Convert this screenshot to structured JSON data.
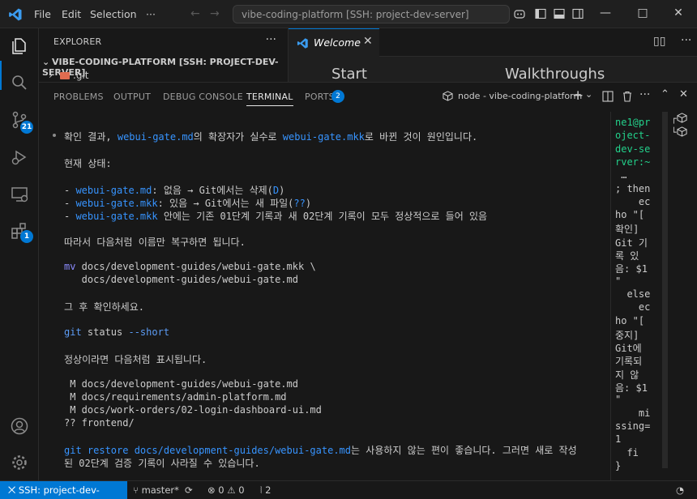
{
  "titlebar": {
    "menu": [
      "File",
      "Edit",
      "Selection",
      "···"
    ],
    "search_text": "vibe-coding-platform [SSH: project-dev-server]",
    "back_icon": "arrow-left-icon",
    "forward_icon": "arrow-right-icon"
  },
  "activity": {
    "scm_badge": "21",
    "extensions_badge": "1"
  },
  "explorer": {
    "title": "EXPLORER",
    "more": "···",
    "root_label": "VIBE-CODING-PLATFORM [SSH: PROJECT-DEV-SERVER]",
    "items": [
      ".git"
    ]
  },
  "editor": {
    "tab_label": "Welcome",
    "start_heading": "Start",
    "walkthroughs_heading": "Walkthroughs"
  },
  "panel": {
    "tabs": [
      "PROBLEMS",
      "OUTPUT",
      "DEBUG CONSOLE",
      "TERMINAL",
      "PORTS"
    ],
    "ports_badge": "2",
    "terminal_name": "node - vibe-coding-platform"
  },
  "terminal": {
    "l1_a": "확인 결과, ",
    "l1_b": "webui-gate.md",
    "l1_c": "의 확장자가 실수로 ",
    "l1_d": "webui-gate.mkk",
    "l1_e": "로 바뀐 것이 원인입니다.",
    "l2": "현재 상태:",
    "l3_a": "- ",
    "l3_b": "webui-gate.md",
    "l3_c": ": 없음 → Git에서는 삭제(",
    "l3_d": "D",
    "l3_e": ")",
    "l4_a": "- ",
    "l4_b": "webui-gate.mkk",
    "l4_c": ": 있음 → Git에서는 새 파일(",
    "l4_d": "??",
    "l4_e": ")",
    "l5_a": "- ",
    "l5_b": "webui-gate.mkk",
    "l5_c": " 안에는 기존 01단계 기록과 새 02단계 기록이 모두 정상적으로 들어 있음",
    "l6": "따라서 다음처럼 이름만 복구하면 됩니다.",
    "l7_a": "mv",
    "l7_b": " docs/development-guides/webui-gate.mkk \\",
    "l8": "   docs/development-guides/webui-gate.md",
    "l9": "그 후 확인하세요.",
    "l10_a": "git",
    "l10_b": " status ",
    "l10_c": "--short",
    "l11": "정상이라면 다음처럼 표시됩니다.",
    "l12": " M docs/development-guides/webui-gate.md",
    "l13": " M docs/requirements/admin-platform.md",
    "l14": " M docs/work-orders/02-login-dashboard-ui.md",
    "l15": "?? frontend/",
    "l16_a": "git restore docs/development-guides/webui-gate.md",
    "l16_b": "는 사용하지 않는 편이 좋습니다. 그러면 새로 작성",
    "l17": "된 02단계 검증 기록이 사라질 수 있습니다."
  },
  "right_terminal": {
    "lines": [
      "ne1@pr",
      "oject-",
      "dev-se",
      "rver:~",
      " …",
      "; then",
      "    ec",
      "ho \"[",
      "확인]",
      "Git 기",
      "록 있",
      "음: $1",
      "\"",
      "  else",
      "    ec",
      "ho \"[",
      "중지]",
      "Git에",
      "기록되",
      "지 않",
      "음: $1",
      "\"",
      "    mi",
      "ssing=",
      "1",
      "  fi",
      "}"
    ]
  },
  "statusbar": {
    "remote": "SSH: project-dev-server",
    "branch": "master*",
    "errors": "0",
    "warnings": "0",
    "ports": "2"
  },
  "colors": {
    "accent": "#0078d4",
    "link": "#3794ff",
    "background": "#1f1f1f"
  }
}
